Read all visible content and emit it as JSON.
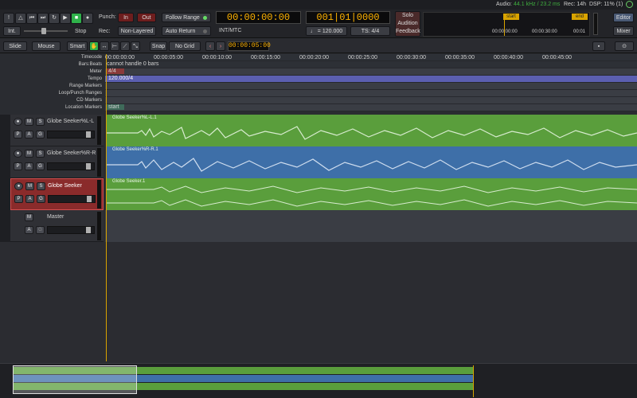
{
  "status": {
    "audio_label": "Audio:",
    "audio_value": "44.1 kHz / 23.2 ms",
    "rec": "Rec: 14h",
    "dsp": "DSP: 11% (1)"
  },
  "transport": {
    "int_label": "Int.",
    "stop_label": "Stop",
    "punch_label": "Punch:",
    "in_label": "In",
    "out_label": "Out",
    "rec_label": "Rec:",
    "rec_mode": "Non-Layered",
    "follow_range": "Follow Range",
    "auto_return": "Auto Return",
    "primary_clock": "00:00:00:00",
    "primary_clock_mode": "INT/MTC",
    "secondary_clock": "001|01|0000",
    "tempo": "♩ = 120.000",
    "ts": "TS: 4/4",
    "solo": "Solo",
    "audition": "Audition",
    "feedback": "Feedback",
    "mini_start": "start",
    "mini_end": "end",
    "mini_times": [
      "00:00:00:00",
      "00:00:30:00",
      "00:01"
    ],
    "editor": "Editor",
    "mixer": "Mixer"
  },
  "edit_toolbar": {
    "slide": "Slide",
    "mouse": "Mouse",
    "smart": "Smart",
    "snap": "Snap",
    "grid": "No Grid",
    "nudge_clock": "00:00:05:00"
  },
  "rulers": {
    "labels": [
      "Timecode",
      "Bars:Beats",
      "Meter",
      "Tempo",
      "Range Markers",
      "Loop/Punch Ranges",
      "CD Markers",
      "Location Markers"
    ],
    "timecode_ticks": [
      "00:00:00:00",
      "00:00:05:00",
      "00:00:10:00",
      "00:00:15:00",
      "00:00:20:00",
      "00:00:25:00",
      "00:00:30:00",
      "00:00:35:00",
      "00:00:40:00",
      "00:00:45:00"
    ],
    "bars_beats_text": "cannot handle 0 bars",
    "meter_text": "4/4",
    "tempo_text": "120.000/4",
    "location_marker": "start"
  },
  "tracks": [
    {
      "name": "Globe Seeker%L-L",
      "region": "Globe Seeker%L-L.1",
      "color": "#5a9e3c"
    },
    {
      "name": "Globe Seeker%R-R",
      "region": "Globe Seeker%R-R.1",
      "color": "#3e6fa8"
    },
    {
      "name": "Globe Seeker",
      "region": "Globe Seeker.1",
      "color": "#5a9e3c"
    }
  ],
  "master": {
    "name": "Master"
  },
  "button_labels": {
    "m": "M",
    "s": "S",
    "p": "P",
    "a": "A",
    "g": "G"
  }
}
